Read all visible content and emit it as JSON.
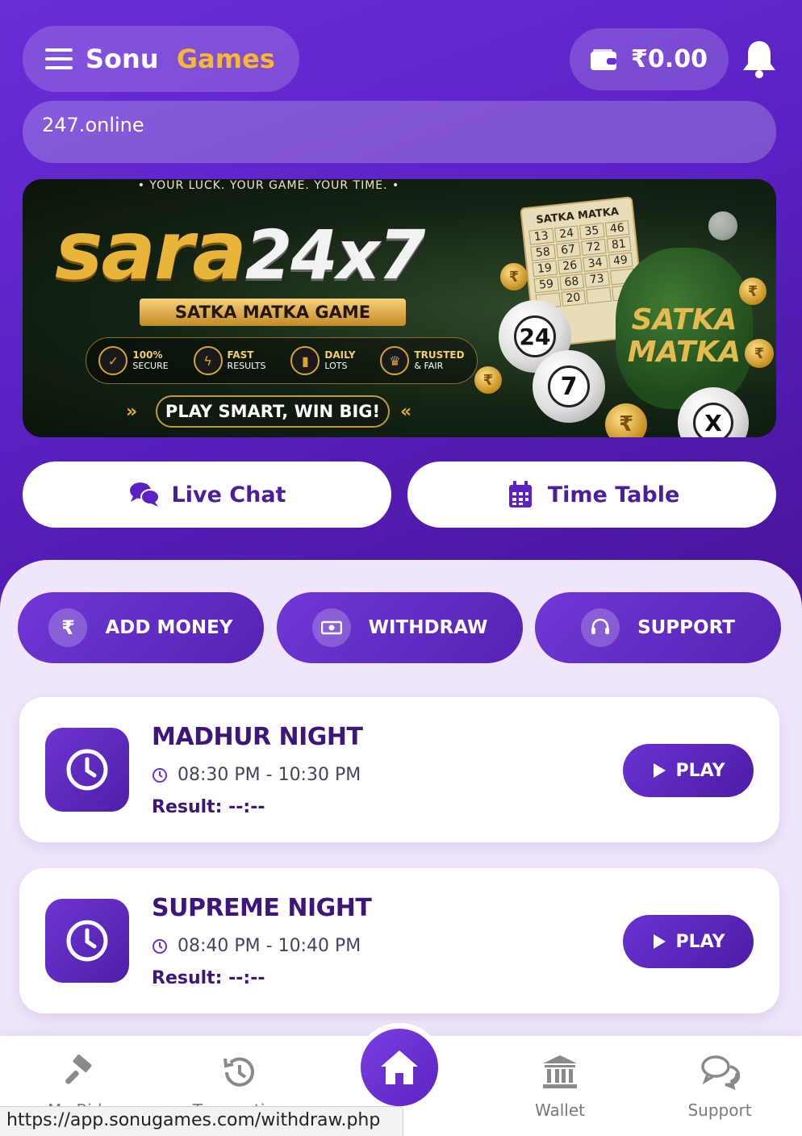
{
  "header": {
    "brand_part1": "Sonu",
    "brand_part2": "Games",
    "wallet_balance": "₹0.00"
  },
  "url_bar": {
    "text": "247.online"
  },
  "banner": {
    "tagline": "• YOUR LUCK. YOUR GAME. YOUR TIME. •",
    "title_gold": "sara",
    "title_white": "24x7",
    "subtitle": "SATKA MATKA GAME",
    "badges": [
      {
        "title": "100%",
        "sub": "SECURE"
      },
      {
        "title": "FAST",
        "sub": "RESULTS"
      },
      {
        "title": "DAILY",
        "sub": "LOTS"
      },
      {
        "title": "TRUSTED",
        "sub": "& FAIR"
      }
    ],
    "cta": "PLAY SMART, WIN BIG!",
    "ticket_title": "SATKA MATKA",
    "ticket_numbers": [
      "13",
      "24",
      "35",
      "46",
      "58",
      "67",
      "72",
      "81",
      "19",
      "26",
      "34",
      "49",
      "59",
      "68",
      "73",
      "",
      "",
      "20",
      "",
      ""
    ],
    "sack_text": "SATKA MATKA",
    "balls": [
      "24",
      "7",
      "X"
    ]
  },
  "quick_links": {
    "live_chat": "Live Chat",
    "time_table": "Time Table"
  },
  "actions": {
    "add_money": "ADD MONEY",
    "withdraw": "WITHDRAW",
    "support": "SUPPORT"
  },
  "games": [
    {
      "name": "MADHUR NIGHT",
      "time": "08:30 PM - 10:30 PM",
      "result": "Result: --:--",
      "play": "PLAY"
    },
    {
      "name": "SUPREME NIGHT",
      "time": "08:40 PM - 10:40 PM",
      "result": "Result: --:--",
      "play": "PLAY"
    }
  ],
  "bottom_nav": {
    "my_bids": "My Bids",
    "transaction": "Transaction",
    "wallet": "Wallet",
    "support": "Support"
  },
  "status_bar": {
    "url": "https://app.sonugames.com/withdraw.php"
  },
  "colors": {
    "primary": "#5a22c4",
    "accent": "#f7b733",
    "dark_text": "#3e1679",
    "panel_bg": "#efe6fb"
  }
}
